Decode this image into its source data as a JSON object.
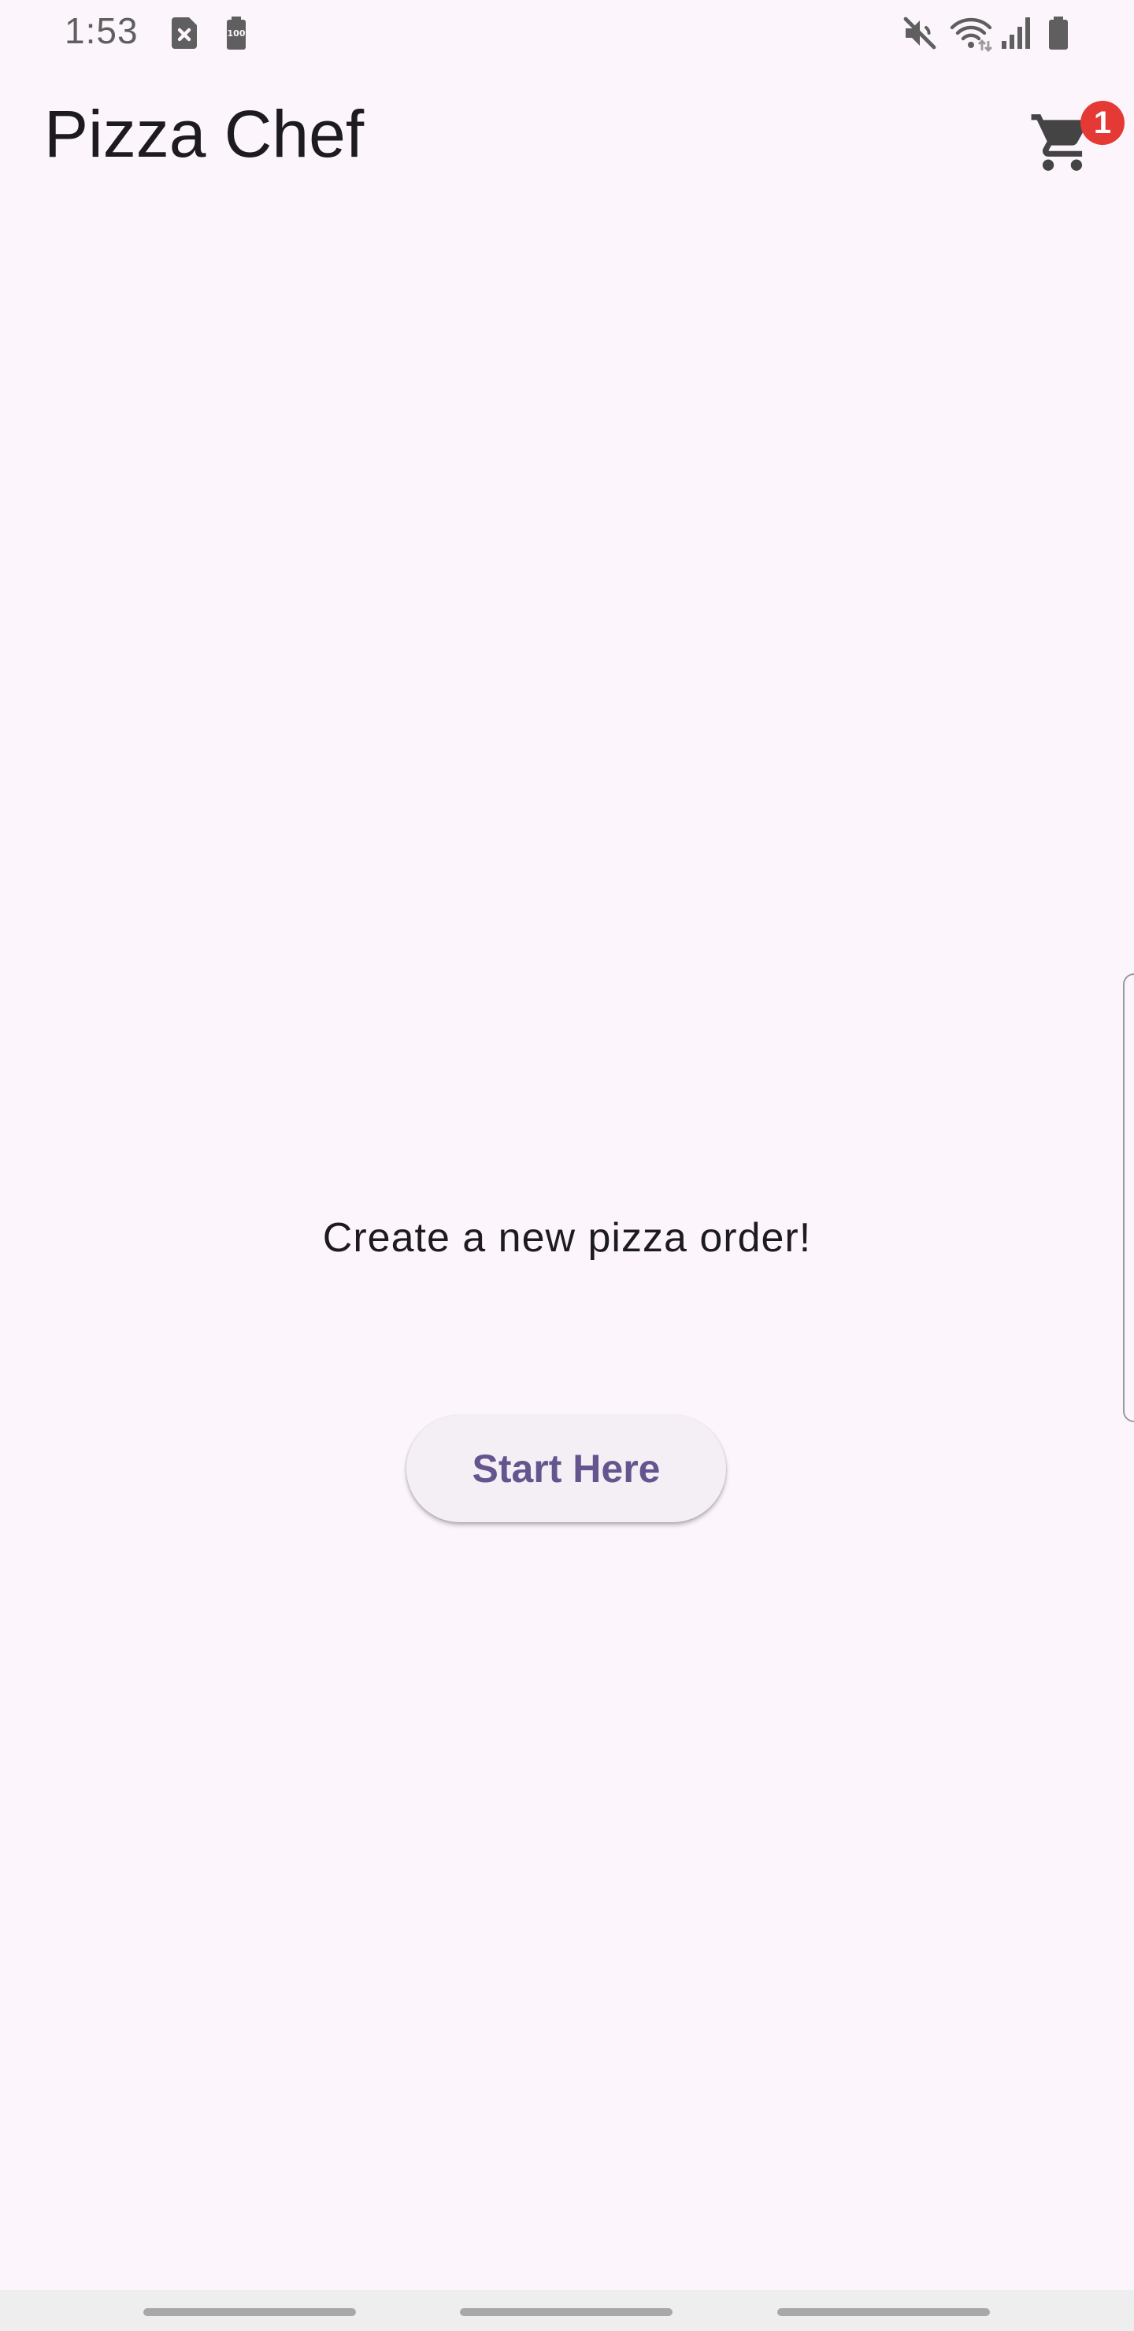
{
  "status_bar": {
    "time": "1:53",
    "icons": [
      "sim-error-icon",
      "battery-saver-icon",
      "mute-icon",
      "wifi-icon",
      "signal-icon",
      "battery-icon"
    ],
    "battery_label": "100"
  },
  "app_bar": {
    "title": "Pizza Chef",
    "cart_icon": "shopping-cart-icon",
    "cart_badge_count": "1",
    "badge_color": "#e53935"
  },
  "main": {
    "prompt": "Create a new pizza order!",
    "start_button_label": "Start Here",
    "accent_color": "#65558f"
  },
  "nav_bar": {
    "buttons": [
      "recent-apps",
      "home",
      "back"
    ]
  },
  "colors": {
    "background": "#fcf6fc",
    "text": "#1d1b20",
    "button_surface": "#f4eff5"
  }
}
